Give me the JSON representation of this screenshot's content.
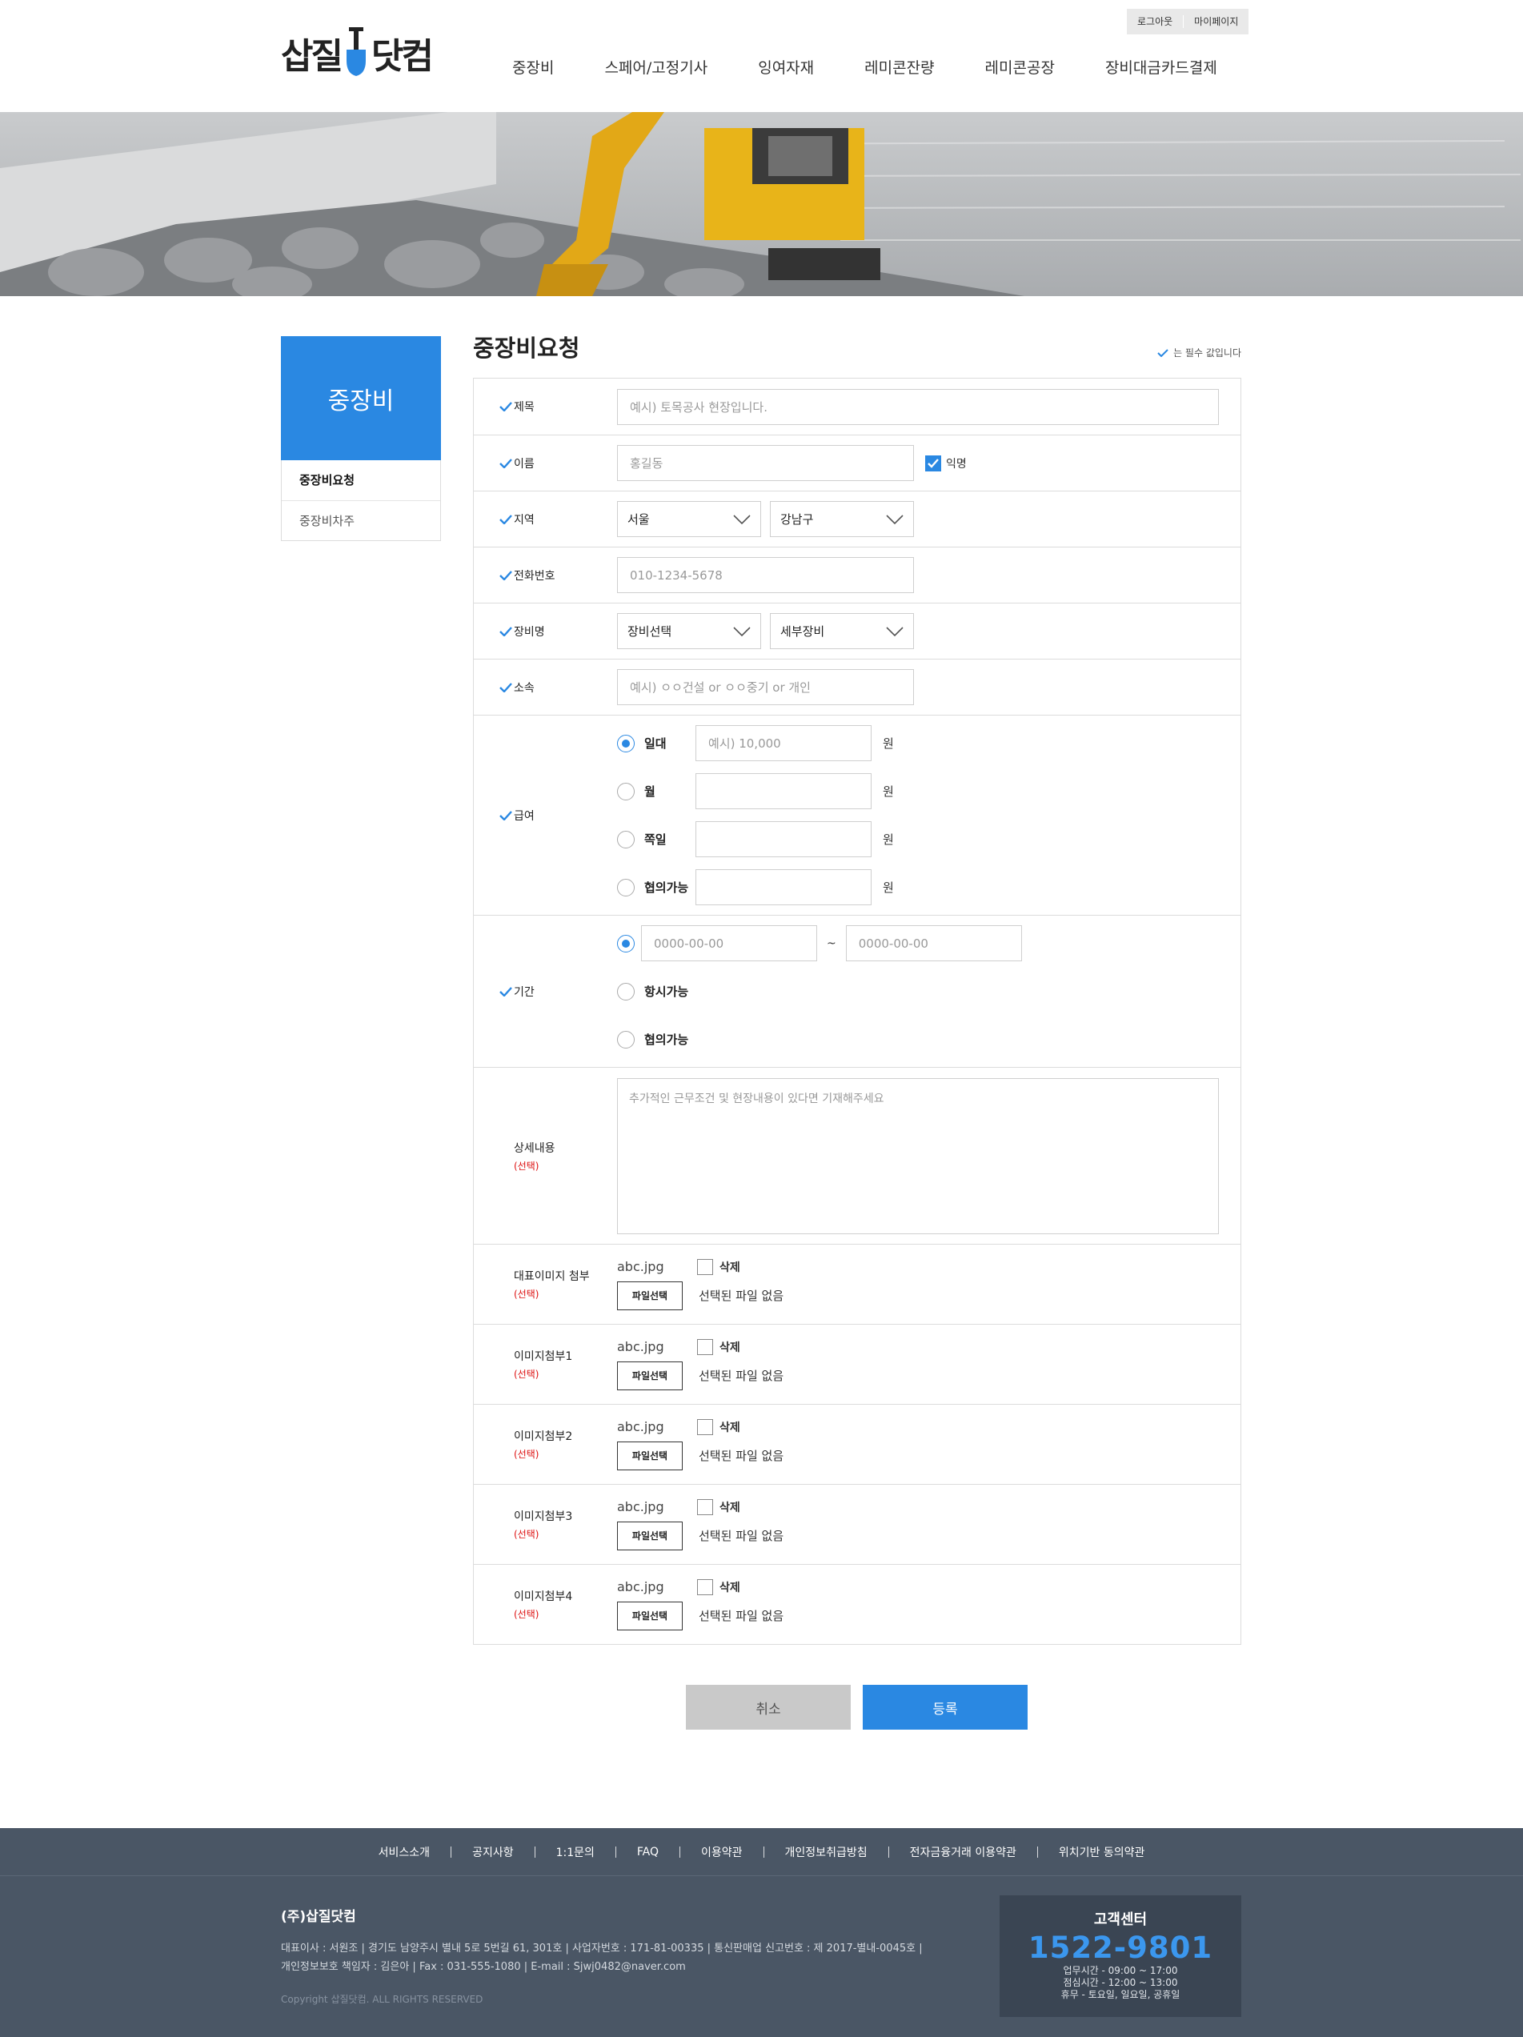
{
  "header": {
    "logo_left": "삽질",
    "logo_right": "닷컴",
    "util": [
      "로그아웃",
      "마이페이지"
    ],
    "gnb": [
      "중장비",
      "스페어/고정기사",
      "잉여자재",
      "레미콘잔량",
      "레미콘공장",
      "장비대금카드결제"
    ]
  },
  "side": {
    "title": "중장비",
    "items": [
      "중장비요청",
      "중장비차주"
    ]
  },
  "content": {
    "title": "중장비요청",
    "required_note": "는 필수 값입니다",
    "labels": {
      "title": "제목",
      "name": "이름",
      "region": "지역",
      "phone": "전화번호",
      "equipment": "장비명",
      "affiliation": "소속",
      "pay": "급여",
      "period": "기간",
      "detail": "상세내용",
      "main_image": "대표이미지 첨부",
      "image1": "이미지첨부1",
      "image2": "이미지첨부2",
      "image3": "이미지첨부3",
      "image4": "이미지첨부4",
      "optional": "(선택)"
    },
    "placeholders": {
      "title": "예시) 토목공사 현장입니다.",
      "name": "홍길동",
      "phone": "010-1234-5678",
      "affiliation": "예시) ㅇㅇ건설 or ㅇㅇ중기 or 개인",
      "pay_daily": "예시) 10,000",
      "date": "0000-00-00",
      "detail": "추가적인 근무조건 및 현장내용이 있다면 기재해주세요"
    },
    "anonymous_label": "익명",
    "region_values": [
      "서울",
      "강남구"
    ],
    "equipment_values": [
      "장비선택",
      "세부장비"
    ],
    "pay_options": [
      "일대",
      "월",
      "쪽일",
      "협의가능"
    ],
    "pay_unit": "원",
    "period_tilde": "~",
    "period_options": [
      "항시가능",
      "협의가능"
    ],
    "file": {
      "name": "abc.jpg",
      "delete": "삭제",
      "button": "파일선택",
      "none": "선택된 파일 없음"
    },
    "buttons": {
      "cancel": "취소",
      "submit": "등록"
    }
  },
  "footer": {
    "nav": [
      "서비스소개",
      "공지사항",
      "1:1문의",
      "FAQ",
      "이용약관",
      "개인정보취급방침",
      "전자금융거래 이용약관",
      "위치기반 동의약관"
    ],
    "company": "(주)삽질닷컴",
    "info1": "대표이사 : 서원조 | 경기도 남양주시 별내 5로 5번길 61, 301호  | 사업자번호 : 171-81-00335 | 통신판매업 신고번호 : 제 2017-별내-0045호 |",
    "info2": "개인정보보호 책임자 : 김은아 | Fax : 031-555-1080 | E-mail : Sjwj0482@naver.com",
    "copyright": "Copyright 삽질닷컴. ALL RIGHTS RESERVED",
    "cs_title": "고객센터",
    "cs_number": "1522-9801",
    "cs_hours": "업무시간 - 09:00 ~ 17:00",
    "cs_lunch": "점심시간 - 12:00 ~ 13:00",
    "cs_off": "휴무  -  토요일, 일요일, 공휴일"
  },
  "colors": {
    "accent": "#2a88e2",
    "footer": "#4a5665",
    "cs_box": "#3a4553",
    "optional": "#dd1111"
  }
}
